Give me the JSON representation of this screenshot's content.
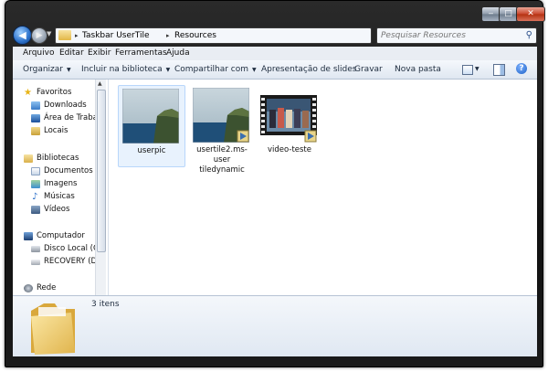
{
  "window": {
    "minimize_glyph": "‒",
    "maximize_glyph": "□",
    "close_glyph": "✕"
  },
  "address": {
    "segments": [
      "Taskbar UserTile",
      "Resources"
    ],
    "separator": "▸"
  },
  "search": {
    "placeholder": "Pesquisar Resources"
  },
  "menu": [
    "Arquivo",
    "Editar",
    "Exibir",
    "Ferramentas",
    "Ajuda"
  ],
  "commands": {
    "organize": "Organizar",
    "include": "Incluir na biblioteca",
    "share": "Compartilhar com",
    "slideshow": "Apresentação de slides",
    "burn": "Gravar",
    "new_folder": "Nova pasta"
  },
  "nav": {
    "favorites": "Favoritos",
    "downloads": "Downloads",
    "desktop": "Área de Trabalh",
    "recent": "Locais",
    "libraries": "Bibliotecas",
    "documents": "Documentos",
    "images": "Imagens",
    "music": "Músicas",
    "videos": "Vídeos",
    "computer": "Computador",
    "local_disk": "Disco Local (C:)",
    "recovery": "RECOVERY (D:)",
    "network": "Rede"
  },
  "files": [
    {
      "name": "userpic",
      "icon": "image-thumbnail-icon",
      "selected": true
    },
    {
      "name": "usertile2.ms-usertiledynamic",
      "line1": "usertile2.ms-user",
      "line2": "tiledynamic",
      "icon": "media-thumbnail-icon",
      "selected": false
    },
    {
      "name": "video-teste",
      "icon": "video-thumbnail-icon",
      "selected": false
    }
  ],
  "details": {
    "item_count": "3 itens"
  },
  "colors": {
    "frame": "#101010",
    "accent": "#2a6fc9",
    "selection": "#e8f2fd"
  }
}
